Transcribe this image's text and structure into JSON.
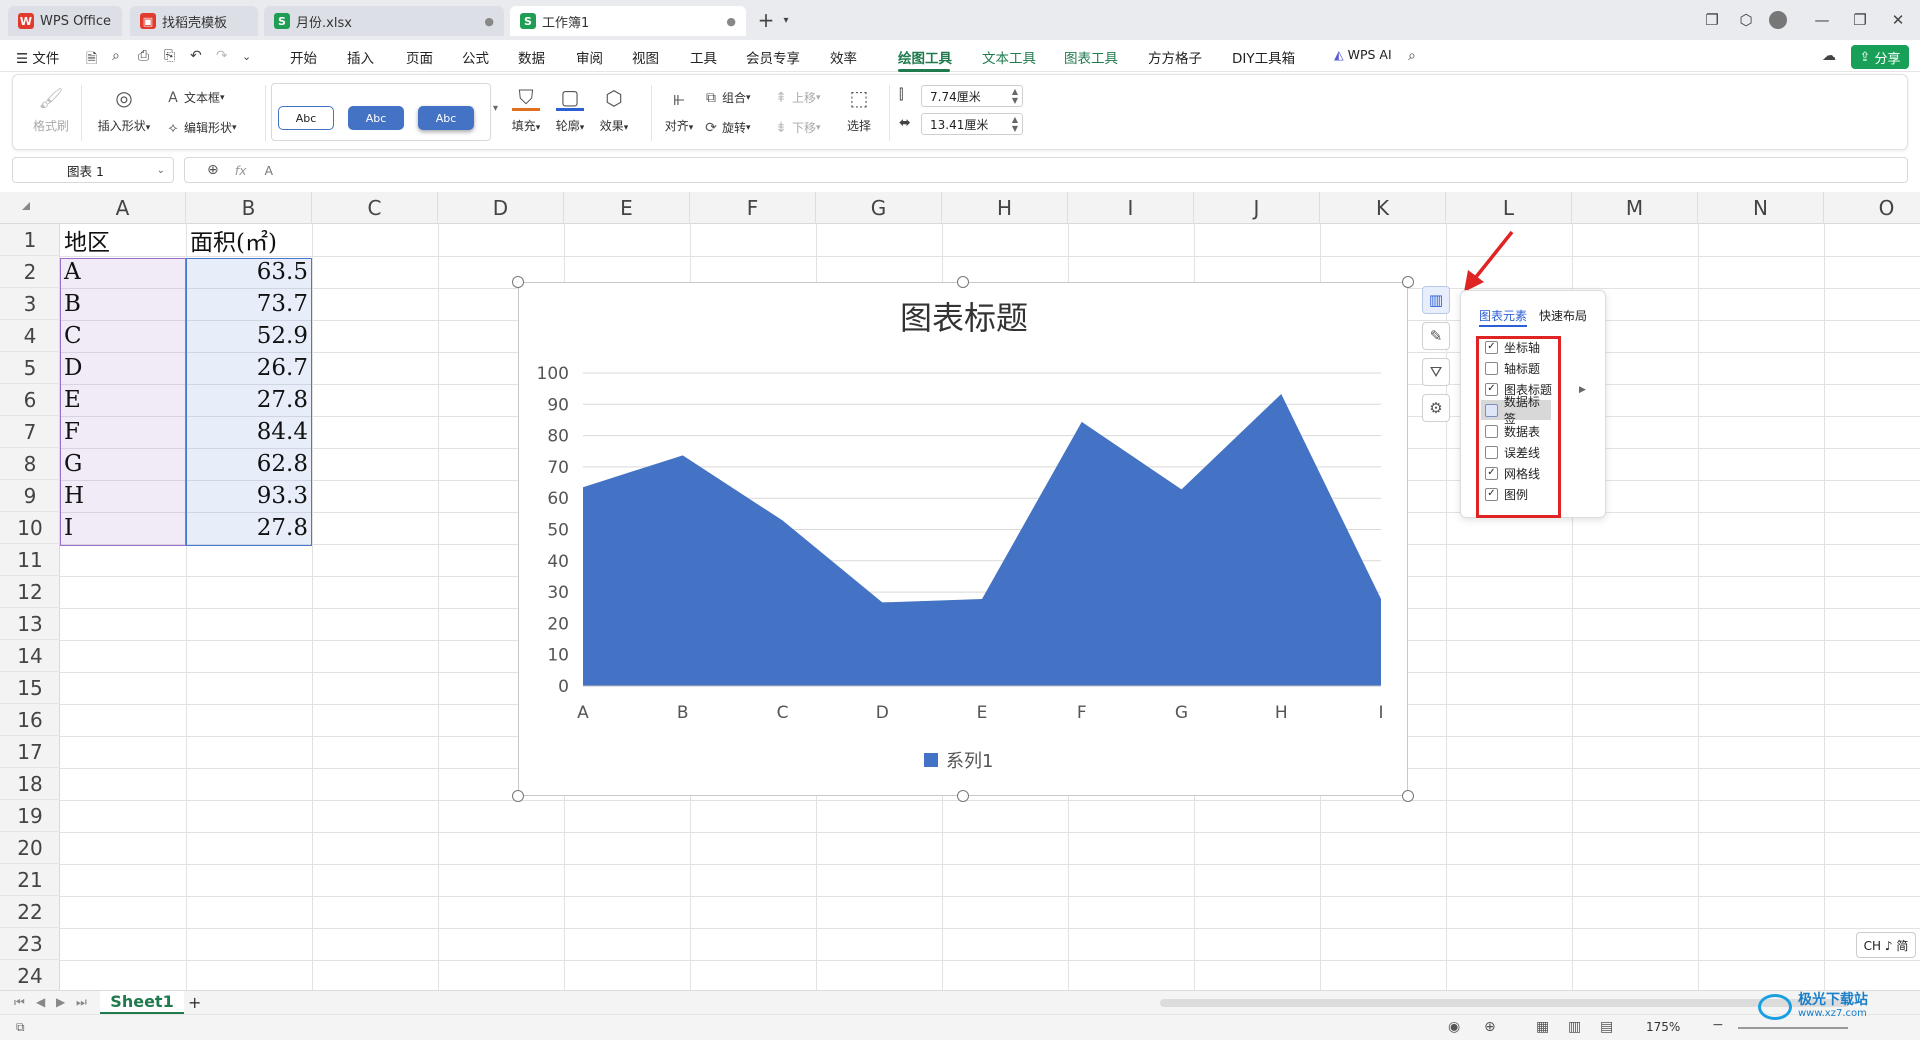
{
  "tabs": [
    {
      "label": "WPS Office",
      "icon": "wps-logo-icon",
      "color": "#e23b2e"
    },
    {
      "label": "找稻壳模板",
      "icon": "docer-icon",
      "color": "#e23b2e"
    },
    {
      "label": "月份.xlsx",
      "icon": "spreadsheet-icon",
      "color": "#1f9d55",
      "glyph": "S"
    },
    {
      "label": "工作簿1",
      "icon": "spreadsheet-icon",
      "color": "#1f9d55",
      "glyph": "S"
    }
  ],
  "menu": {
    "file": "文件",
    "items": [
      "开始",
      "插入",
      "页面",
      "公式",
      "数据",
      "审阅",
      "视图",
      "工具",
      "会员专享",
      "效率",
      "绘图工具",
      "文本工具",
      "图表工具",
      "方方格子",
      "DIY工具箱"
    ],
    "active": "绘图工具",
    "wps_ai": "WPS AI",
    "share": "分享"
  },
  "ribbon": {
    "format_painter": "格式刷",
    "insert_shape": "插入形状",
    "text_box": "文本框",
    "edit_shape": "编辑形状",
    "styles": [
      "Abc",
      "Abc",
      "Abc"
    ],
    "fill": "填充",
    "outline": "轮廓",
    "effect": "效果",
    "align": "对齐",
    "group": "组合",
    "rotate": "旋转",
    "bring_forward": "上移",
    "send_backward": "下移",
    "select": "选择",
    "height": "7.74厘米",
    "width": "13.41厘米"
  },
  "formula": {
    "name_box": "图表 1",
    "fx": "fx",
    "content": "A"
  },
  "sheet": {
    "columns": [
      "A",
      "B",
      "C",
      "D",
      "E",
      "F",
      "G",
      "H",
      "I",
      "J",
      "K",
      "L",
      "M",
      "N",
      "O"
    ],
    "rows": [
      "1",
      "2",
      "3",
      "4",
      "5",
      "6",
      "7",
      "8",
      "9",
      "10",
      "11",
      "12",
      "13",
      "14",
      "15",
      "16",
      "17",
      "18",
      "19",
      "20",
      "21",
      "22",
      "23",
      "24"
    ],
    "header_region": "地区",
    "header_area": "面积(㎡)",
    "data": [
      {
        "region": "A",
        "area": "63.5"
      },
      {
        "region": "B",
        "area": "73.7"
      },
      {
        "region": "C",
        "area": "52.9"
      },
      {
        "region": "D",
        "area": "26.7"
      },
      {
        "region": "E",
        "area": "27.8"
      },
      {
        "region": "F",
        "area": "84.4"
      },
      {
        "region": "G",
        "area": "62.8"
      },
      {
        "region": "H",
        "area": "93.3"
      },
      {
        "region": "I",
        "area": "27.8"
      }
    ],
    "sheet_tab": "Sheet1",
    "add_sheet": "+"
  },
  "chart_data": {
    "type": "area",
    "title": "图表标题",
    "categories": [
      "A",
      "B",
      "C",
      "D",
      "E",
      "F",
      "G",
      "H",
      "I"
    ],
    "series": [
      {
        "name": "系列1",
        "values": [
          63.5,
          73.7,
          52.9,
          26.7,
          27.8,
          84.4,
          62.8,
          93.3,
          27.8
        ]
      }
    ],
    "ylim": [
      0,
      100
    ],
    "yticks": [
      "100",
      "90",
      "80",
      "70",
      "60",
      "50",
      "40",
      "30",
      "20",
      "10",
      "0"
    ],
    "grid": true,
    "legend": "bottom",
    "color": "#4472c4"
  },
  "elements_panel": {
    "tab_elements": "图表元素",
    "tab_layout": "快速布局",
    "items": [
      {
        "label": "坐标轴",
        "checked": true
      },
      {
        "label": "轴标题",
        "checked": false
      },
      {
        "label": "图表标题",
        "checked": true
      },
      {
        "label": "数据标签",
        "checked": false
      },
      {
        "label": "数据表",
        "checked": false
      },
      {
        "label": "误差线",
        "checked": false
      },
      {
        "label": "网格线",
        "checked": true
      },
      {
        "label": "图例",
        "checked": true
      }
    ],
    "check_glyph": "✓"
  },
  "status": {
    "zoom": "175%",
    "ime": "CH ♪ 简",
    "watermark": "极光下载站",
    "watermark_url": "www.xz7.com"
  }
}
